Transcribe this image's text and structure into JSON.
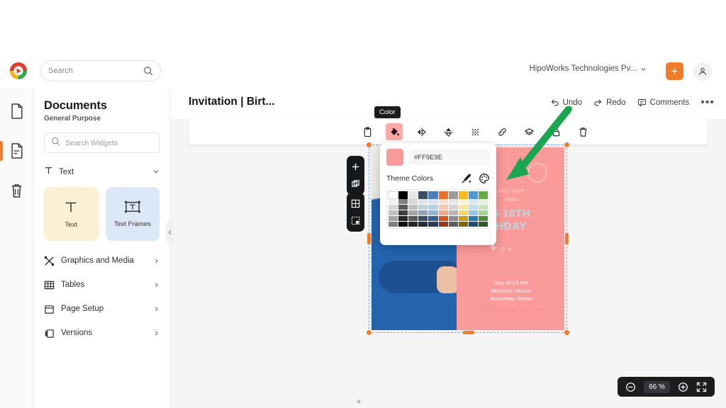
{
  "app": {
    "brand": "zoho-writer-logo",
    "accent": "#ef7c2b",
    "selection_color": "#ef7c2b"
  },
  "topbar": {
    "search": {
      "placeholder": "Search",
      "value": "",
      "icon": "search-icon"
    },
    "org_name": "HipoWorks Technologies Pv...",
    "org_chevron": "chevron-down-icon",
    "add_label": "+",
    "profile_icon": "user-avatar-icon"
  },
  "rail": {
    "items": [
      {
        "name": "document-blank",
        "icon": "document-icon",
        "active": false
      },
      {
        "name": "document-lines",
        "icon": "document-text-icon",
        "active": true
      },
      {
        "name": "trash",
        "icon": "trash-icon",
        "active": false
      }
    ]
  },
  "panel": {
    "title": "Documents",
    "subtitle": "General Purpose",
    "search": {
      "placeholder": "Search Widgets",
      "value": "",
      "icon": "search-icon"
    },
    "group": {
      "label": "Text",
      "icon": "text-T-icon",
      "chevron": "chevron-down-icon"
    },
    "cards": [
      {
        "label": "Text",
        "icon": "text-T-icon",
        "color": "#fdf0d2"
      },
      {
        "label": "Text Frames",
        "icon": "text-frame-icon",
        "color": "#dce8f7"
      }
    ],
    "nav": [
      {
        "label": "Graphics and Media",
        "icon": "graphics-media-icon",
        "chevron": "chevron-right-icon"
      },
      {
        "label": "Tables",
        "icon": "table-grid-icon",
        "chevron": "chevron-right-icon"
      },
      {
        "label": "Page Setup",
        "icon": "page-setup-icon",
        "chevron": "chevron-right-icon"
      },
      {
        "label": "Versions",
        "icon": "versions-icon",
        "chevron": "chevron-right-icon"
      }
    ],
    "collapse_icon": "collapse-panel-icon"
  },
  "editor": {
    "doc_title": "Invitation | Birt...",
    "actions": [
      {
        "label": "Undo",
        "icon": "undo-icon"
      },
      {
        "label": "Redo",
        "icon": "redo-icon"
      },
      {
        "label": "Comments",
        "icon": "comment-icon"
      }
    ],
    "more_icon": "more-options-icon"
  },
  "toolbar": {
    "tooltip": "Color",
    "buttons": [
      {
        "name": "clipboard-icon",
        "selected": false
      },
      {
        "name": "fill-color-icon",
        "selected": true
      },
      {
        "name": "flip-horizontal-icon",
        "selected": false
      },
      {
        "name": "flip-vertical-icon",
        "selected": false
      },
      {
        "name": "pattern-icon",
        "selected": false
      },
      {
        "name": "link-icon",
        "selected": false
      },
      {
        "name": "layers-icon",
        "selected": false
      },
      {
        "name": "lock-icon",
        "selected": false
      },
      {
        "name": "delete-icon",
        "selected": false
      }
    ]
  },
  "mini_toolbars": [
    {
      "icons": [
        "add-plus-icon",
        "duplicate-icon"
      ]
    },
    {
      "icons": [
        "table-icon",
        "select-area-icon"
      ]
    }
  ],
  "color_popup": {
    "hex_value": "#FF9E9E",
    "swatch_color": "#FB9A9A",
    "section_label": "Theme Colors",
    "eyedropper_icon": "eyedropper-off-icon",
    "palette_icon": "palette-icon",
    "theme_row": [
      "#ffffff",
      "#000000",
      "#e7e7e7",
      "#3d4e63",
      "#4a7ebb",
      "#e8702a",
      "#9b9b9b",
      "#f5bb1d",
      "#4d97d4",
      "#6aab44"
    ],
    "tint_rows": [
      [
        "#f2f2f2",
        "#7f7f7f",
        "#d6d6d6",
        "#dce3ea",
        "#dbe5f1",
        "#fbe0d2",
        "#e8e8e8",
        "#fdf2cd",
        "#dbeaf6",
        "#e4f0db"
      ],
      [
        "#d8d8d8",
        "#595959",
        "#bfbfbf",
        "#c3cfdb",
        "#b8cce4",
        "#f9c6ab",
        "#d3d3d3",
        "#fce79c",
        "#bfdcef",
        "#c9e1b8"
      ],
      [
        "#bfbfbf",
        "#3f3f3f",
        "#a5a5a5",
        "#8fa3b8",
        "#95b3d7",
        "#f5a882",
        "#b5b5b5",
        "#fbd961",
        "#94c5e5",
        "#a9d18e"
      ],
      [
        "#a5a5a5",
        "#262626",
        "#595959",
        "#3d4e63",
        "#376092",
        "#d8541b",
        "#8c8c8c",
        "#c9a214",
        "#2a7ab5",
        "#4f8c33"
      ],
      [
        "#7f7f7f",
        "#0d0d0d",
        "#262626",
        "#222c38",
        "#253b59",
        "#923a12",
        "#5c5c5c",
        "#7f6709",
        "#1b4f74",
        "#31561f"
      ]
    ]
  },
  "artboard": {
    "text_save": "and save\ndate",
    "text_headline": "S 10TH\nHDAY",
    "text_details": "Sep 25 | 6 PM\nStewarts House\nBroadway Street",
    "text_rsvp": "RSVP David at 12345678",
    "background_color": "#FB9A9A",
    "stars": "✦✧✦"
  },
  "zoombar": {
    "zoom_out_icon": "zoom-out-icon",
    "value": "66 %",
    "zoom_in_icon": "zoom-in-icon",
    "fit_icon": "fit-screen-icon"
  },
  "annotation": {
    "arrow_color": "#1aa551"
  }
}
